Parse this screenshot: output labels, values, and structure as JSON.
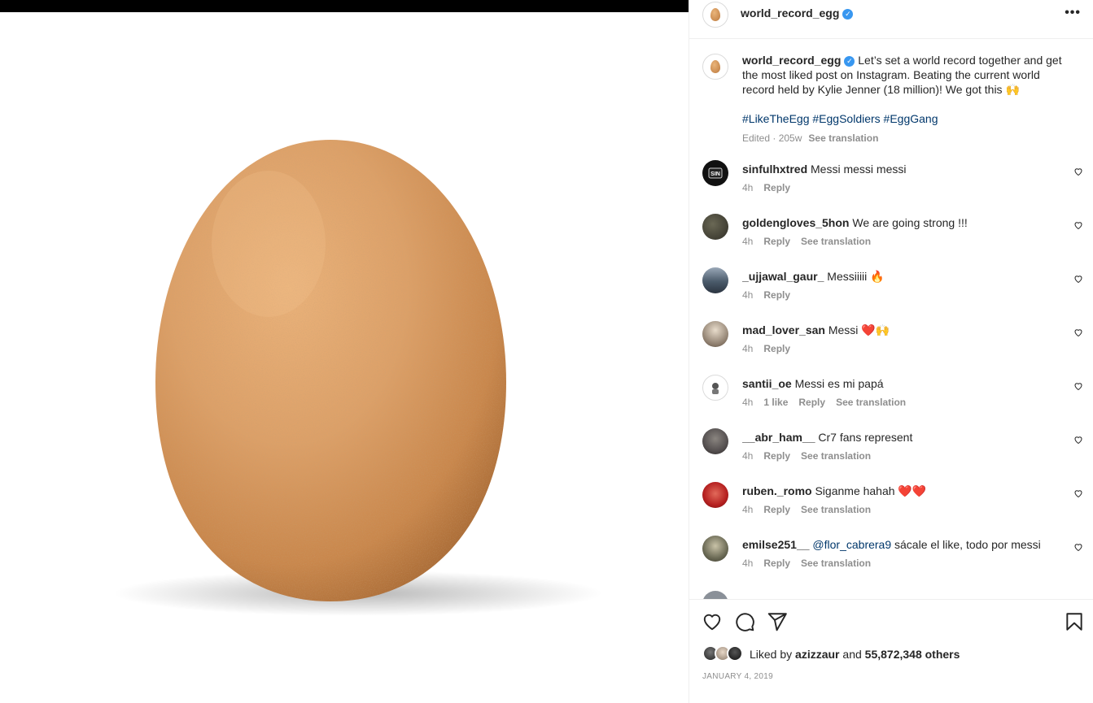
{
  "post": {
    "username": "world_record_egg",
    "caption_text": "Let’s set a world record together and get the most liked post on Instagram. Beating the current world record held by Kylie Jenner (18 million)! We got this 🙌",
    "hashtags": "#LikeTheEgg #EggSoldiers #EggGang",
    "caption_meta": "Edited · 205w",
    "see_translation": "See translation",
    "more_icon": "more-horizontal-icon"
  },
  "comments": [
    {
      "user": "sinfulhxtred",
      "text": "Messi messi messi",
      "time": "4h",
      "likes": "",
      "reply": "Reply",
      "translate": "",
      "avatar_color": "#111111"
    },
    {
      "user": "goldengloves_5hon",
      "text": "We are going strong !!!",
      "time": "4h",
      "likes": "",
      "reply": "Reply",
      "translate": "See translation",
      "avatar_color": "#3b3a30"
    },
    {
      "user": "_ujjawal_gaur_",
      "text": "Messiiiii 🔥",
      "time": "4h",
      "likes": "",
      "reply": "Reply",
      "translate": "",
      "avatar_color": "#4a5a6a"
    },
    {
      "user": "mad_lover_san",
      "text": "Messi ❤️🙌",
      "time": "4h",
      "likes": "",
      "reply": "Reply",
      "translate": "",
      "avatar_color": "#8a7a6a"
    },
    {
      "user": "santii_oe",
      "text": "Messi es mi papá",
      "time": "4h",
      "likes": "1 like",
      "reply": "Reply",
      "translate": "See translation",
      "avatar_color": "#f2f2f2"
    },
    {
      "user": "__abr_ham__",
      "text": "Cr7 fans represent",
      "time": "4h",
      "likes": "",
      "reply": "Reply",
      "translate": "See translation",
      "avatar_color": "#555050"
    },
    {
      "user": "ruben._romo",
      "text": "Siganme hahah ❤️❤️",
      "time": "4h",
      "likes": "",
      "reply": "Reply",
      "translate": "See translation",
      "avatar_color": "#b52020"
    },
    {
      "user": "emilse251__",
      "mention": "@flor_cabrera9",
      "text": "sácale el like, todo por messi",
      "time": "4h",
      "likes": "",
      "reply": "Reply",
      "translate": "See translation",
      "avatar_color": "#6b6a55"
    }
  ],
  "actions": {
    "like_icon": "heart-icon",
    "comment_icon": "comment-icon",
    "share_icon": "share-icon",
    "save_icon": "bookmark-icon"
  },
  "likes": {
    "prefix": "Liked by",
    "user": "azizzaur",
    "middle": "and",
    "count": "55,872,348 others"
  },
  "date": "JANUARY 4, 2019"
}
